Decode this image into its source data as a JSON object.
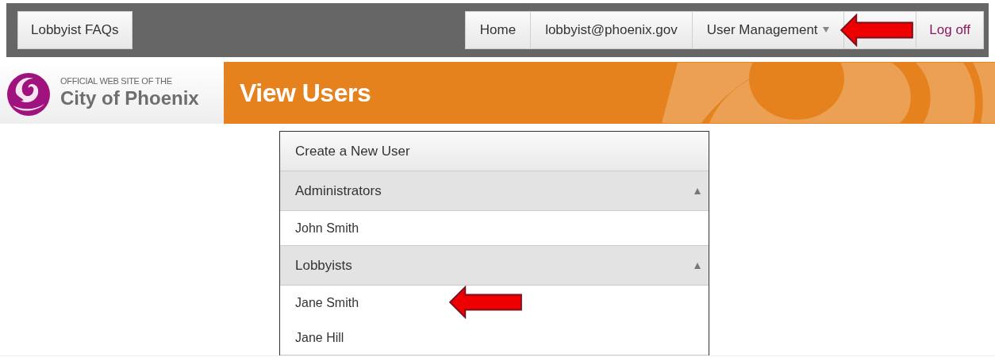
{
  "top_nav": {
    "left_button": "Lobbyist FAQs",
    "items": [
      {
        "kind": "link",
        "label": "Home"
      },
      {
        "kind": "link",
        "label": "lobbyist@phoenix.gov"
      },
      {
        "kind": "dropdown",
        "label": "User Management"
      },
      {
        "kind": "covered"
      },
      {
        "kind": "logout",
        "label": "Log off"
      }
    ]
  },
  "header": {
    "site_tagline": "OFFICIAL WEB SITE OF THE",
    "site_name": "City of Phoenix",
    "page_title": "View Users"
  },
  "panel": {
    "create_link": "Create a New User",
    "groups": [
      {
        "name": "Administrators",
        "expanded": true,
        "users": [
          "John Smith"
        ]
      },
      {
        "name": "Lobbyists",
        "expanded": true,
        "users": [
          "Jane Smith",
          "Jane Hill"
        ]
      }
    ]
  }
}
